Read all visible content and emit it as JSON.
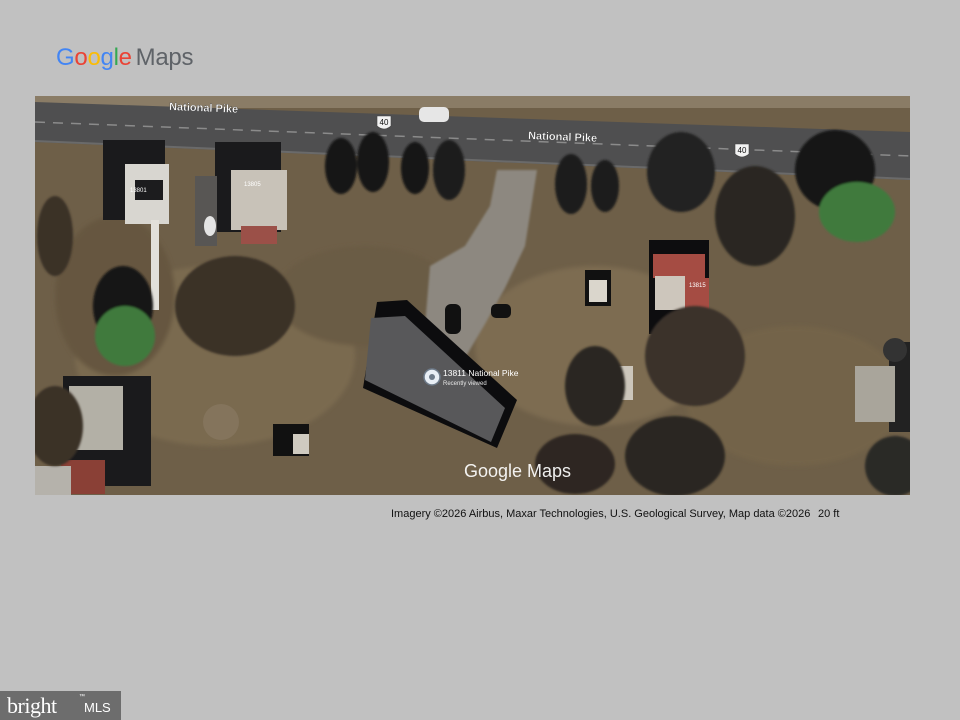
{
  "logo": {
    "letters": [
      {
        "ch": "G",
        "color": "#4285F4"
      },
      {
        "ch": "o",
        "color": "#EA4335"
      },
      {
        "ch": "o",
        "color": "#FBBC05"
      },
      {
        "ch": "g",
        "color": "#4285F4"
      },
      {
        "ch": "l",
        "color": "#34A853"
      },
      {
        "ch": "e",
        "color": "#EA4335"
      }
    ],
    "suffix": "Maps"
  },
  "map": {
    "road_name": "National Pike",
    "route_shield": "40",
    "house_numbers": [
      "13801",
      "13805",
      "13815"
    ],
    "pin": {
      "address": "13811 National Pike",
      "subtitle": "Recently viewed"
    },
    "watermark": "Google Maps"
  },
  "attribution": "Imagery ©2026 Airbus, Maxar Technologies, U.S. Geological Survey, Map data ©2026",
  "scale": "20 ft",
  "badge": {
    "main": "bright",
    "tm": "™",
    "suffix": "MLS"
  }
}
